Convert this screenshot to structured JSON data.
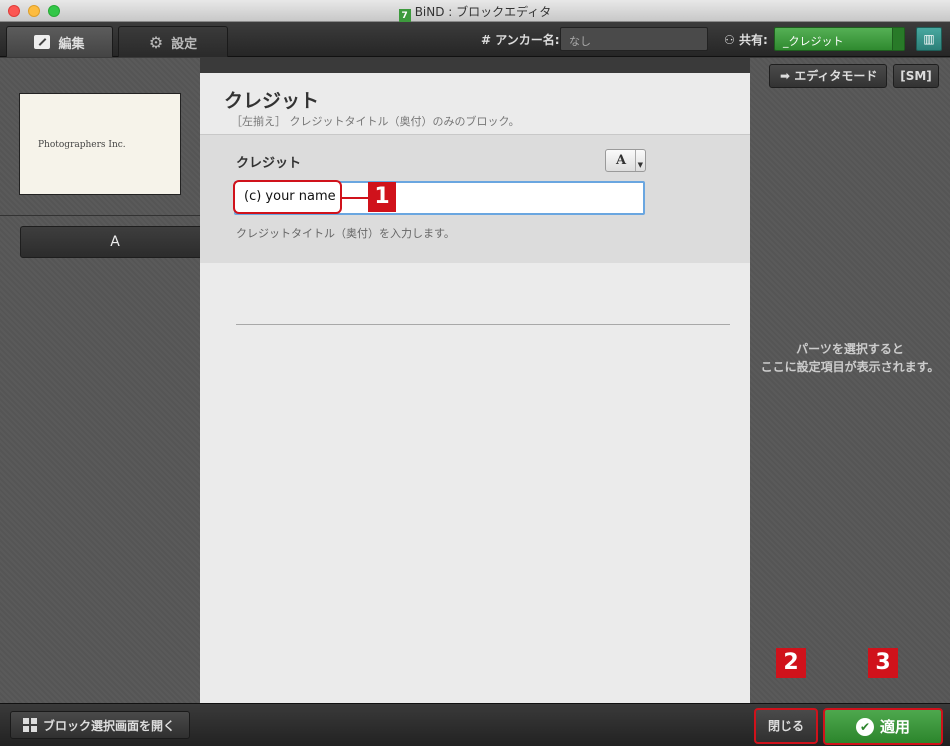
{
  "window": {
    "app_badge": "7",
    "title": "BiND : ブロックエディタ"
  },
  "toolbar": {
    "tab_edit": "編集",
    "tab_settings": "設定",
    "anchor_label": "# アンカー名:",
    "anchor_value": "なし",
    "share_label": "共有:",
    "share_value": "_クレジット"
  },
  "left": {
    "thumbnail_text": "Photographers Inc.",
    "block_item": "A"
  },
  "main": {
    "block_title": "クレジット",
    "block_description": "［左揃え］ クレジットタイトル（奥付）のみのブロック。",
    "field_label": "クレジット",
    "font_button": "A",
    "field_value": "(c) your name",
    "field_help": "クレジットタイトル（奥付）を入力します。"
  },
  "callouts": {
    "one": "1",
    "two": "2",
    "three": "3"
  },
  "right": {
    "editor_mode": "エディタモード",
    "sm": "[SM]",
    "hint_line1": "パーツを選択すると",
    "hint_line2": "ここに設定項目が表示されます。"
  },
  "bottom": {
    "open_block_select": "ブロック選択画面を開く",
    "close": "閉じる",
    "apply": "適用"
  },
  "colors": {
    "accent_green": "#3d9a3d",
    "callout_red": "#d0121b",
    "input_focus": "#6aa6e0"
  }
}
